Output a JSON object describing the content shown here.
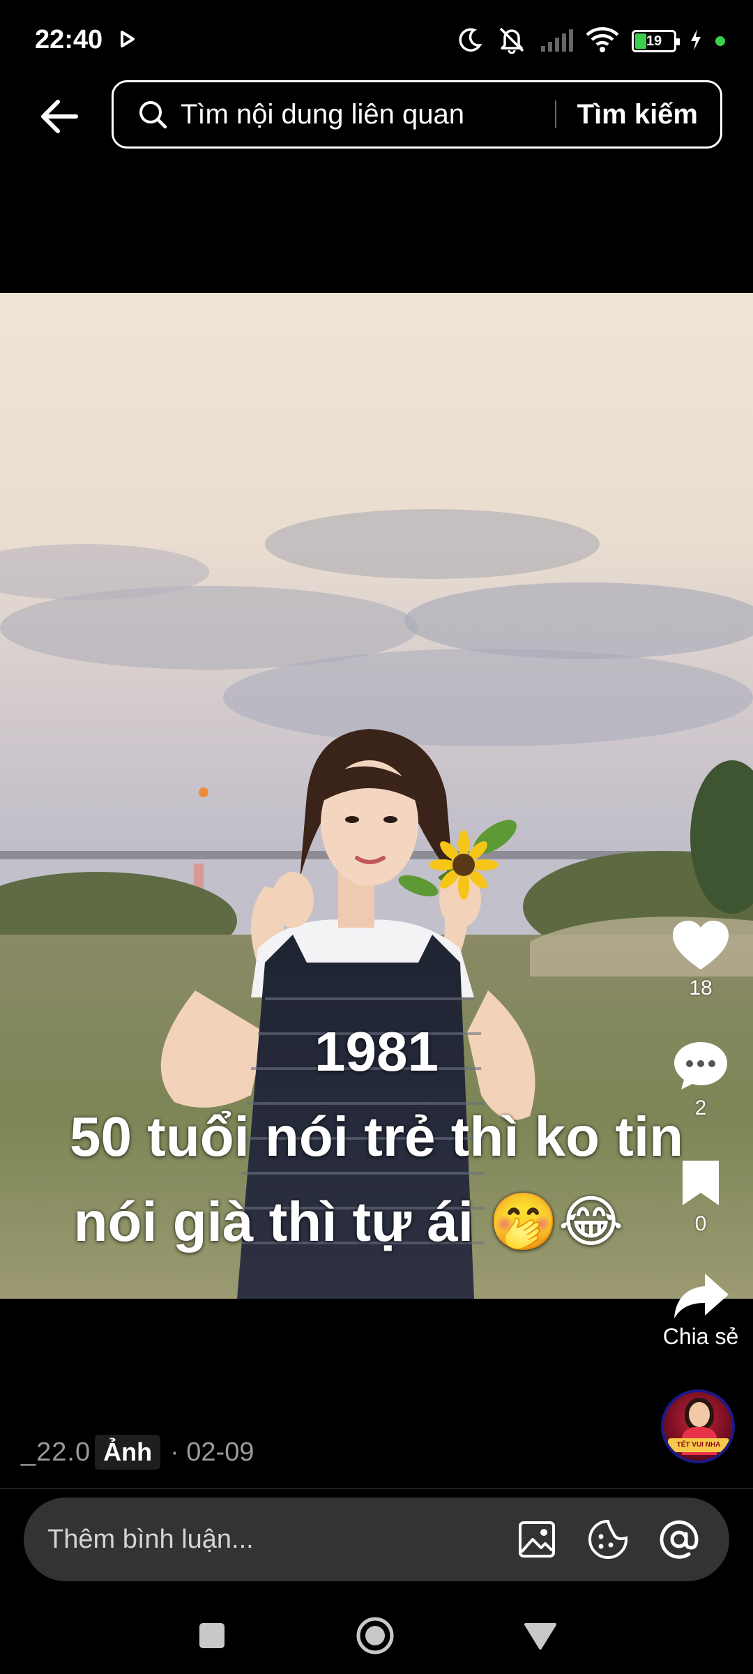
{
  "status_bar": {
    "time": "22:40",
    "battery_level": "19",
    "icons": [
      "play-icon",
      "moon-icon",
      "mute-icon",
      "signal-icon",
      "wifi-icon",
      "battery-icon",
      "charging-icon"
    ]
  },
  "header": {
    "back_icon": "back-arrow-icon",
    "search_placeholder": "Tìm nội dung liên quan",
    "search_button": "Tìm kiếm"
  },
  "post": {
    "overlay_lines": [
      "1981",
      "50 tuổi nói trẻ thì ko tin",
      "nói già thì tự ái 🤭😂"
    ]
  },
  "actions": {
    "likes": "18",
    "comments": "2",
    "saves": "0",
    "share_label": "Chia sẻ"
  },
  "caption": {
    "fragment": "_22.0",
    "type_label": "Ảnh",
    "date": "· 02-09"
  },
  "comment_bar": {
    "placeholder": "Thêm bình luận..."
  },
  "colors": {
    "background": "#000000",
    "comment_bar": "#333333",
    "battery_green": "#3ccf4e"
  }
}
